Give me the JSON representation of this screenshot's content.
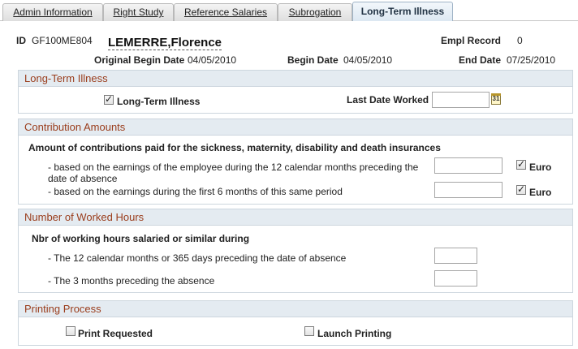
{
  "tabs": [
    {
      "label": "Admin Information"
    },
    {
      "label": "Right Study"
    },
    {
      "label": "Reference Salaries"
    },
    {
      "label": "Subrogation"
    },
    {
      "label": "Long-Term Illness"
    }
  ],
  "header": {
    "id_label": "ID",
    "id_value": "GF100ME804",
    "name": "LEMERRE,Florence",
    "empl_record_label": "Empl Record",
    "empl_record_value": "0",
    "orig_begin_label": "Original Begin Date",
    "orig_begin_value": "04/05/2010",
    "begin_label": "Begin Date",
    "begin_value": "04/05/2010",
    "end_label": "End Date",
    "end_value": "07/25/2010"
  },
  "long_term_illness": {
    "title": "Long-Term Illness",
    "checkbox_label": "Long-Term Illness",
    "checked": true,
    "last_date_label": "Last Date Worked",
    "last_date_value": "",
    "calendar_glyph": "31"
  },
  "contribution": {
    "title": "Contribution Amounts",
    "heading": "Amount of contributions paid for the sickness, maternity, disability and death insurances",
    "line1": "- based on the earnings of the employee during the 12 calendar months preceding the date of absence",
    "line2": "- based on the earnings during the first 6 months of this same period",
    "amount1": "",
    "amount2": "",
    "euro_label": "Euro",
    "euro1_checked": true,
    "euro2_checked": true
  },
  "worked_hours": {
    "title": "Number of Worked Hours",
    "heading": "Nbr of working hours salaried or similar during",
    "line1": "- The 12 calendar months or 365 days preceding the date of absence",
    "line2": "- The 3 months preceding the absence",
    "hours1": "",
    "hours2": ""
  },
  "printing": {
    "title": "Printing Process",
    "print_requested_label": "Print Requested",
    "launch_printing_label": "Launch Printing",
    "print_requested_checked": false,
    "launch_printing_checked": false
  }
}
